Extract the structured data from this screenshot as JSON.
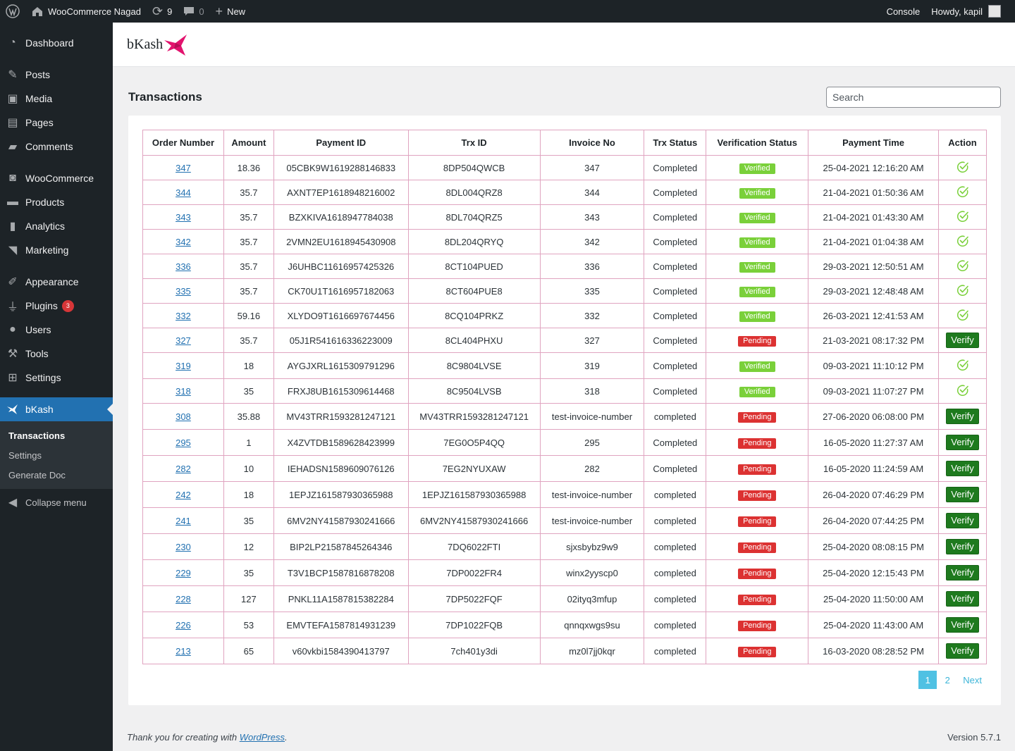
{
  "adminbar": {
    "site_name": "WooCommerce Nagad",
    "updates_count": "9",
    "comments_count": "0",
    "new_label": "New",
    "console_label": "Console",
    "howdy": "Howdy, kapil"
  },
  "sidebar": {
    "items": [
      {
        "label": "Dashboard"
      },
      {
        "label": "Posts"
      },
      {
        "label": "Media"
      },
      {
        "label": "Pages"
      },
      {
        "label": "Comments"
      },
      {
        "label": "WooCommerce"
      },
      {
        "label": "Products"
      },
      {
        "label": "Analytics"
      },
      {
        "label": "Marketing"
      },
      {
        "label": "Appearance"
      },
      {
        "label": "Plugins",
        "badge": "3"
      },
      {
        "label": "Users"
      },
      {
        "label": "Tools"
      },
      {
        "label": "Settings"
      },
      {
        "label": "bKash"
      }
    ],
    "submenu": [
      "Transactions",
      "Settings",
      "Generate Doc"
    ],
    "collapse": "Collapse menu"
  },
  "header": {
    "logo_text": "bKash"
  },
  "page": {
    "title": "Transactions",
    "search_placeholder": "Search"
  },
  "table": {
    "columns": [
      "Order Number",
      "Amount",
      "Payment ID",
      "Trx ID",
      "Invoice No",
      "Trx Status",
      "Verification Status",
      "Payment Time",
      "Action"
    ],
    "rows": [
      {
        "order": "347",
        "amount": "18.36",
        "payment_id": "05CBK9W1619288146833",
        "trx_id": "8DP504QWCB",
        "invoice": "347",
        "trx_status": "Completed",
        "verification": "Verified",
        "time": "25-04-2021 12:16:20 AM",
        "action": "check"
      },
      {
        "order": "344",
        "amount": "35.7",
        "payment_id": "AXNT7EP1618948216002",
        "trx_id": "8DL004QRZ8",
        "invoice": "344",
        "trx_status": "Completed",
        "verification": "Verified",
        "time": "21-04-2021 01:50:36 AM",
        "action": "check"
      },
      {
        "order": "343",
        "amount": "35.7",
        "payment_id": "BZXKIVA1618947784038",
        "trx_id": "8DL704QRZ5",
        "invoice": "343",
        "trx_status": "Completed",
        "verification": "Verified",
        "time": "21-04-2021 01:43:30 AM",
        "action": "check"
      },
      {
        "order": "342",
        "amount": "35.7",
        "payment_id": "2VMN2EU1618945430908",
        "trx_id": "8DL204QRYQ",
        "invoice": "342",
        "trx_status": "Completed",
        "verification": "Verified",
        "time": "21-04-2021 01:04:38 AM",
        "action": "check"
      },
      {
        "order": "336",
        "amount": "35.7",
        "payment_id": "J6UHBC11616957425326",
        "trx_id": "8CT104PUED",
        "invoice": "336",
        "trx_status": "Completed",
        "verification": "Verified",
        "time": "29-03-2021 12:50:51 AM",
        "action": "check"
      },
      {
        "order": "335",
        "amount": "35.7",
        "payment_id": "CK70U1T1616957182063",
        "trx_id": "8CT604PUE8",
        "invoice": "335",
        "trx_status": "Completed",
        "verification": "Verified",
        "time": "29-03-2021 12:48:48 AM",
        "action": "check"
      },
      {
        "order": "332",
        "amount": "59.16",
        "payment_id": "XLYDO9T1616697674456",
        "trx_id": "8CQ104PRKZ",
        "invoice": "332",
        "trx_status": "Completed",
        "verification": "Verified",
        "time": "26-03-2021 12:41:53 AM",
        "action": "check"
      },
      {
        "order": "327",
        "amount": "35.7",
        "payment_id": "05J1R541616336223009",
        "trx_id": "8CL404PHXU",
        "invoice": "327",
        "trx_status": "Completed",
        "verification": "Pending",
        "time": "21-03-2021 08:17:32 PM",
        "action": "Verify"
      },
      {
        "order": "319",
        "amount": "18",
        "payment_id": "AYGJXRL1615309791296",
        "trx_id": "8C9804LVSE",
        "invoice": "319",
        "trx_status": "Completed",
        "verification": "Verified",
        "time": "09-03-2021 11:10:12 PM",
        "action": "check"
      },
      {
        "order": "318",
        "amount": "35",
        "payment_id": "FRXJ8UB1615309614468",
        "trx_id": "8C9504LVSB",
        "invoice": "318",
        "trx_status": "Completed",
        "verification": "Verified",
        "time": "09-03-2021 11:07:27 PM",
        "action": "check"
      },
      {
        "order": "308",
        "amount": "35.88",
        "payment_id": "MV43TRR1593281247121",
        "trx_id": "MV43TRR1593281247121",
        "invoice": "test-invoice-number",
        "trx_status": "completed",
        "verification": "Pending",
        "time": "27-06-2020 06:08:00 PM",
        "action": "Verify"
      },
      {
        "order": "295",
        "amount": "1",
        "payment_id": "X4ZVTDB1589628423999",
        "trx_id": "7EG0O5P4QQ",
        "invoice": "295",
        "trx_status": "Completed",
        "verification": "Pending",
        "time": "16-05-2020 11:27:37 AM",
        "action": "Verify"
      },
      {
        "order": "282",
        "amount": "10",
        "payment_id": "IEHADSN1589609076126",
        "trx_id": "7EG2NYUXAW",
        "invoice": "282",
        "trx_status": "Completed",
        "verification": "Pending",
        "time": "16-05-2020 11:24:59 AM",
        "action": "Verify"
      },
      {
        "order": "242",
        "amount": "18",
        "payment_id": "1EPJZ161587930365988",
        "trx_id": "1EPJZ161587930365988",
        "invoice": "test-invoice-number",
        "trx_status": "completed",
        "verification": "Pending",
        "time": "26-04-2020 07:46:29 PM",
        "action": "Verify"
      },
      {
        "order": "241",
        "amount": "35",
        "payment_id": "6MV2NY41587930241666",
        "trx_id": "6MV2NY41587930241666",
        "invoice": "test-invoice-number",
        "trx_status": "completed",
        "verification": "Pending",
        "time": "26-04-2020 07:44:25 PM",
        "action": "Verify"
      },
      {
        "order": "230",
        "amount": "12",
        "payment_id": "BIP2LP21587845264346",
        "trx_id": "7DQ6022FTI",
        "invoice": "sjxsbybz9w9",
        "trx_status": "completed",
        "verification": "Pending",
        "time": "25-04-2020 08:08:15 PM",
        "action": "Verify"
      },
      {
        "order": "229",
        "amount": "35",
        "payment_id": "T3V1BCP1587816878208",
        "trx_id": "7DP0022FR4",
        "invoice": "winx2yyscp0",
        "trx_status": "completed",
        "verification": "Pending",
        "time": "25-04-2020 12:15:43 PM",
        "action": "Verify"
      },
      {
        "order": "228",
        "amount": "127",
        "payment_id": "PNKL11A1587815382284",
        "trx_id": "7DP5022FQF",
        "invoice": "02ityq3mfup",
        "trx_status": "completed",
        "verification": "Pending",
        "time": "25-04-2020 11:50:00 AM",
        "action": "Verify"
      },
      {
        "order": "226",
        "amount": "53",
        "payment_id": "EMVTEFA1587814931239",
        "trx_id": "7DP1022FQB",
        "invoice": "qnnqxwgs9su",
        "trx_status": "completed",
        "verification": "Pending",
        "time": "25-04-2020 11:43:00 AM",
        "action": "Verify"
      },
      {
        "order": "213",
        "amount": "65",
        "payment_id": "v60vkbi1584390413797",
        "trx_id": "7ch401y3di",
        "invoice": "mz0l7jj0kqr",
        "trx_status": "completed",
        "verification": "Pending",
        "time": "16-03-2020 08:28:52 PM",
        "action": "Verify"
      }
    ]
  },
  "pagination": {
    "pages": [
      "1",
      "2"
    ],
    "current": "1",
    "next": "Next"
  },
  "footer": {
    "thanks_prefix": "Thank you for creating with ",
    "wordpress_link": "WordPress",
    "thanks_suffix": ".",
    "version": "Version 5.7.1"
  },
  "colors": {
    "accent": "#2271b1",
    "verified": "#7ad03a",
    "pending": "#dc3232",
    "verify_button": "#1e7a1e",
    "bkash": "#e2136e",
    "table_border": "#e0a4c0"
  }
}
